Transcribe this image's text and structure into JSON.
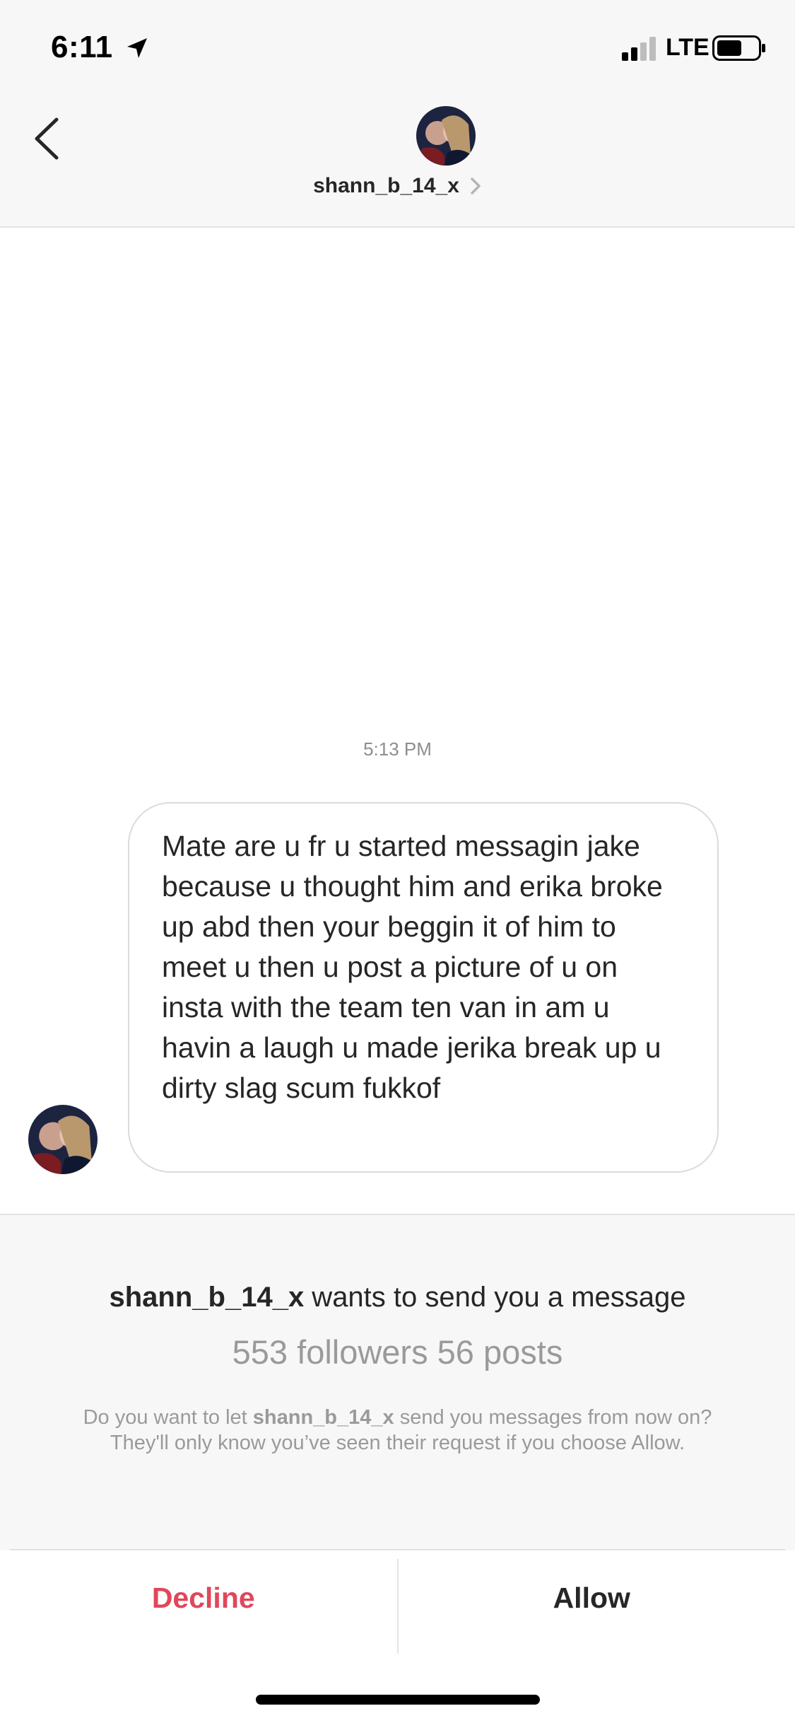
{
  "status_bar": {
    "time": "6:11",
    "network": "LTE"
  },
  "header": {
    "username": "shann_b_14_x"
  },
  "chat": {
    "timestamp": "5:13 PM",
    "message": "Mate are u fr u started messagin jake because u thought him and erika broke up abd then your beggin it of him to meet u then u post a picture of u on insta with the team ten van in am u havin a laugh u made jerika break up u dirty slag scum fukkof"
  },
  "request": {
    "username": "shann_b_14_x",
    "title_suffix": " wants to send you a message",
    "stats": "553 followers 56 posts",
    "desc_prefix": "Do you want to let ",
    "desc_username": "shann_b_14_x",
    "desc_suffix": " send you messages from now on? They'll only know you’ve seen their request if you choose Allow."
  },
  "actions": {
    "decline_label": "Decline",
    "allow_label": "Allow"
  },
  "colors": {
    "decline": "#e0475a",
    "muted": "#9a9a9a"
  }
}
